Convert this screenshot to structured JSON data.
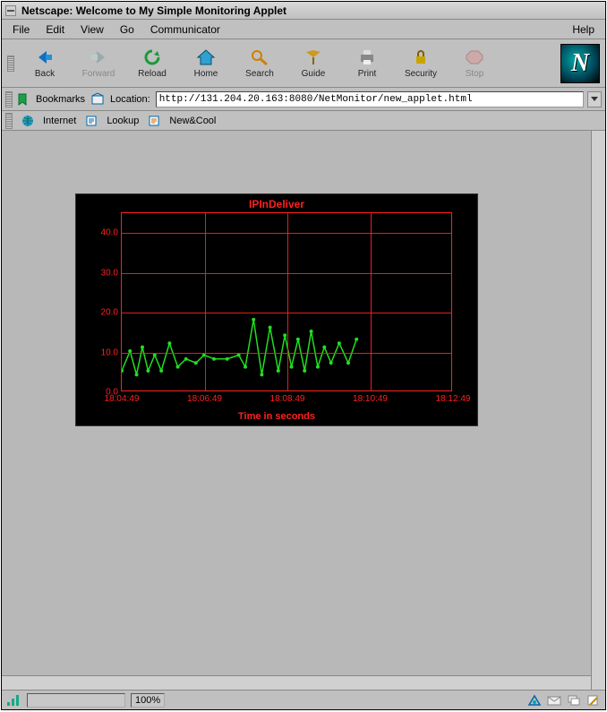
{
  "window": {
    "title": "Netscape: Welcome to My Simple Monitoring Applet"
  },
  "menu": {
    "file": "File",
    "edit": "Edit",
    "view": "View",
    "go": "Go",
    "communicator": "Communicator",
    "help": "Help"
  },
  "toolbar": {
    "back": "Back",
    "forward": "Forward",
    "reload": "Reload",
    "home": "Home",
    "search": "Search",
    "guide": "Guide",
    "print": "Print",
    "security": "Security",
    "stop": "Stop"
  },
  "location": {
    "bookmarks": "Bookmarks",
    "label": "Location:",
    "url": "http://131.204.20.163:8080/NetMonitor/new_applet.html"
  },
  "linksbar": {
    "internet": "Internet",
    "lookup": "Lookup",
    "newcool": "New&Cool"
  },
  "status": {
    "pct": "100%"
  },
  "chart_data": {
    "type": "line",
    "title": "IPInDeliver",
    "xlabel": "Time in seconds",
    "ylabel": "",
    "ylim": [
      0,
      45
    ],
    "yticks": [
      "0.0",
      "10.0",
      "20.0",
      "30.0",
      "40.0"
    ],
    "xticks": [
      "18:04:49",
      "18:06:49",
      "18:08:49",
      "18:10:49",
      "18:12:49"
    ],
    "x": [
      0,
      10,
      18,
      25,
      32,
      40,
      48,
      58,
      68,
      78,
      90,
      100,
      112,
      128,
      142,
      150,
      160,
      170,
      180,
      190,
      198,
      206,
      214,
      222,
      230,
      238,
      246,
      254,
      264,
      275,
      285
    ],
    "values": [
      5,
      10,
      4,
      11,
      5,
      9,
      5,
      12,
      6,
      8,
      7,
      9,
      8,
      8,
      9,
      6,
      18,
      4,
      16,
      5,
      14,
      6,
      13,
      5,
      15,
      6,
      11,
      7,
      12,
      7,
      13
    ]
  }
}
